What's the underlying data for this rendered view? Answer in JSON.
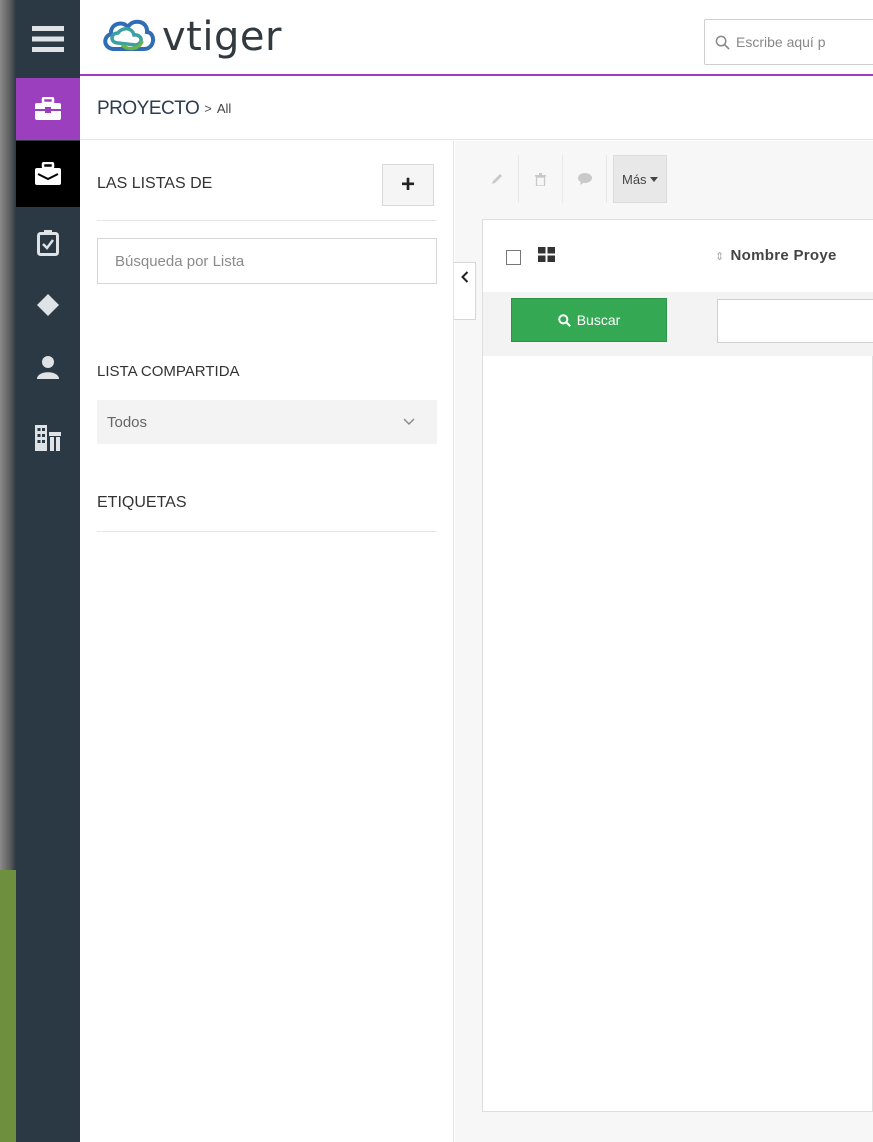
{
  "app": {
    "logo_text": "vtiger"
  },
  "header": {
    "search_placeholder": "Escribe aquí p"
  },
  "breadcrumb": {
    "module": "PROYECTO",
    "separator": ">",
    "view": "All"
  },
  "sidebar": {
    "items": [
      {
        "icon": "menu-icon"
      },
      {
        "icon": "briefcase-icon",
        "active": "purple"
      },
      {
        "icon": "project-icon",
        "active": "black"
      },
      {
        "icon": "clipboard-check-icon"
      },
      {
        "icon": "diamond-icon"
      },
      {
        "icon": "user-icon"
      },
      {
        "icon": "building-icon"
      }
    ]
  },
  "lists_panel": {
    "title": "LAS LISTAS DE",
    "add_label": "+",
    "search_placeholder": "Búsqueda por Lista",
    "shared_title": "LISTA COMPARTIDA",
    "shared_value": "Todos",
    "tags_title": "ETIQUETAS"
  },
  "toolbar": {
    "more_label": "Más"
  },
  "list": {
    "column_header": "Nombre Proye",
    "search_button": "Buscar"
  },
  "colors": {
    "rail_bg": "#2b3945",
    "accent_purple": "#9b3fbf",
    "search_green": "#35a853"
  }
}
